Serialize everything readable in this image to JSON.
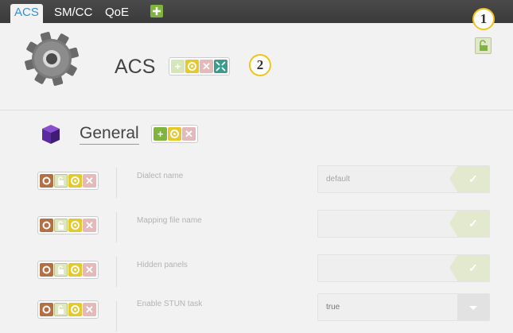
{
  "tabs": [
    {
      "label": "ACS",
      "active": true
    },
    {
      "label": "SM/CC",
      "active": false
    },
    {
      "label": "QoE",
      "active": false
    }
  ],
  "add_tab_icon": "plus-icon",
  "callouts": [
    "1",
    "2"
  ],
  "header": {
    "title": "ACS",
    "icon": "gear-icon",
    "actions": [
      "add-icon",
      "configure-icon",
      "delete-icon",
      "collapse-icon"
    ]
  },
  "lock_icon": "unlock-icon",
  "section": {
    "title": "General",
    "icon": "cube-icon",
    "actions": [
      "add-icon",
      "configure-icon",
      "delete-icon"
    ]
  },
  "fields": [
    {
      "label": "Dialect name",
      "value": "default",
      "type": "text"
    },
    {
      "label": "Mapping file name",
      "value": "",
      "type": "text"
    },
    {
      "label": "Hidden panels",
      "value": "",
      "type": "text"
    },
    {
      "label": "Enable STUN task",
      "value": "true",
      "type": "select"
    }
  ],
  "colors": {
    "topbar": "#3a3a3a",
    "active_tab_text": "#3a8fd0",
    "add_green": "#7fb53f",
    "config_yellow": "#e6c928",
    "delete_pink": "#e3b9b9",
    "callout_border": "#f0c419"
  }
}
